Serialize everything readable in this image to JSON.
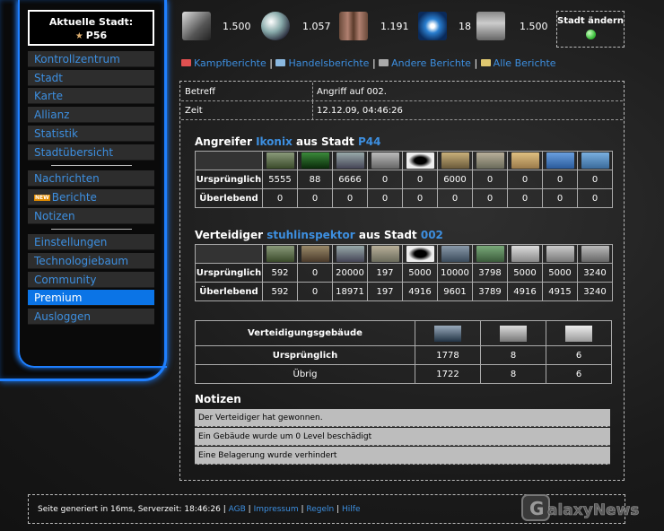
{
  "sidebar": {
    "city_header": "Aktuelle Stadt:",
    "city_name": "P56",
    "items_group1": [
      "Kontrollzentrum",
      "Stadt",
      "Karte",
      "Allianz",
      "Statistik",
      "Stadtübersicht"
    ],
    "items_group2": [
      "Nachrichten",
      "Berichte",
      "Notizen"
    ],
    "new_badge": "NEW",
    "items_group3": [
      "Einstellungen",
      "Technologiebaum",
      "Community",
      "Premium",
      "Ausloggen"
    ],
    "active_item": "Premium"
  },
  "resources": [
    "1.500",
    "1.057",
    "1.191",
    "18",
    "1.500"
  ],
  "change_city": "Stadt ändern",
  "report_links": {
    "kampf": "Kampfberichte",
    "handel": "Handelsberichte",
    "andere": "Andere Berichte",
    "alle": "Alle Berichte",
    "sep": "|"
  },
  "meta": {
    "subject_label": "Betreff",
    "subject_value": "Angriff auf 002.",
    "time_label": "Zeit",
    "time_value": "12.12.09, 04:46:26"
  },
  "attacker": {
    "prefix": "Angreifer",
    "name": "Ikonix",
    "mid": "aus Stadt",
    "city": "P44",
    "row1_label": "Ursprünglich",
    "row1": [
      "5555",
      "88",
      "6666",
      "0",
      "0",
      "6000",
      "0",
      "0",
      "0",
      "0"
    ],
    "row2_label": "Überlebend",
    "row2": [
      "0",
      "0",
      "0",
      "0",
      "0",
      "0",
      "0",
      "0",
      "0",
      "0"
    ]
  },
  "defender": {
    "prefix": "Verteidiger",
    "name": "stuhlinspektor",
    "mid": "aus Stadt",
    "city": "002",
    "row1_label": "Ursprünglich",
    "row1": [
      "592",
      "0",
      "20000",
      "197",
      "5000",
      "10000",
      "3798",
      "5000",
      "5000",
      "3240"
    ],
    "row2_label": "Überlebend",
    "row2": [
      "592",
      "0",
      "18971",
      "197",
      "4916",
      "9601",
      "3789",
      "4916",
      "4915",
      "3240"
    ]
  },
  "buildings": {
    "header": "Verteidigungsgebäude",
    "row1_label": "Ursprünglich",
    "row1": [
      "1778",
      "8",
      "6"
    ],
    "row2_label": "Übrig",
    "row2": [
      "1722",
      "8",
      "6"
    ]
  },
  "notes": {
    "title": "Notizen",
    "items": [
      "Der Verteidiger hat gewonnen.",
      "Ein Gebäude wurde um 0 Level beschädigt",
      "Eine Belagerung wurde verhindert"
    ]
  },
  "footer": {
    "text": "Seite generiert in 16ms, Serverzeit: 18:46:26",
    "links": [
      "AGB",
      "Impressum",
      "Regeln",
      "Hilfe"
    ],
    "sep": "|"
  },
  "watermark": "GalaxyNews",
  "colors": {
    "accent": "#1e7fff",
    "link": "#3d8fe0",
    "active": "#0b74e6"
  }
}
